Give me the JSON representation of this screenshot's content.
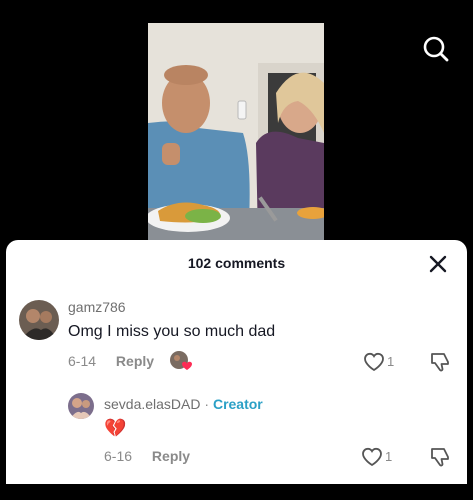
{
  "sheet": {
    "title": "102 comments"
  },
  "comments": [
    {
      "username": "gamz786",
      "text": "Omg I miss you so much dad",
      "date": "6-14",
      "reply_label": "Reply",
      "likes": "1"
    }
  ],
  "replies": [
    {
      "username": "sevda.elasDAD",
      "separator": "·",
      "creator_label": "Creator",
      "text": "💔",
      "date": "6-16",
      "reply_label": "Reply",
      "likes": "1"
    }
  ],
  "colors": {
    "creator": "#2aa0c6",
    "sheet_bg": "#ffffff",
    "backdrop": "#000000"
  }
}
